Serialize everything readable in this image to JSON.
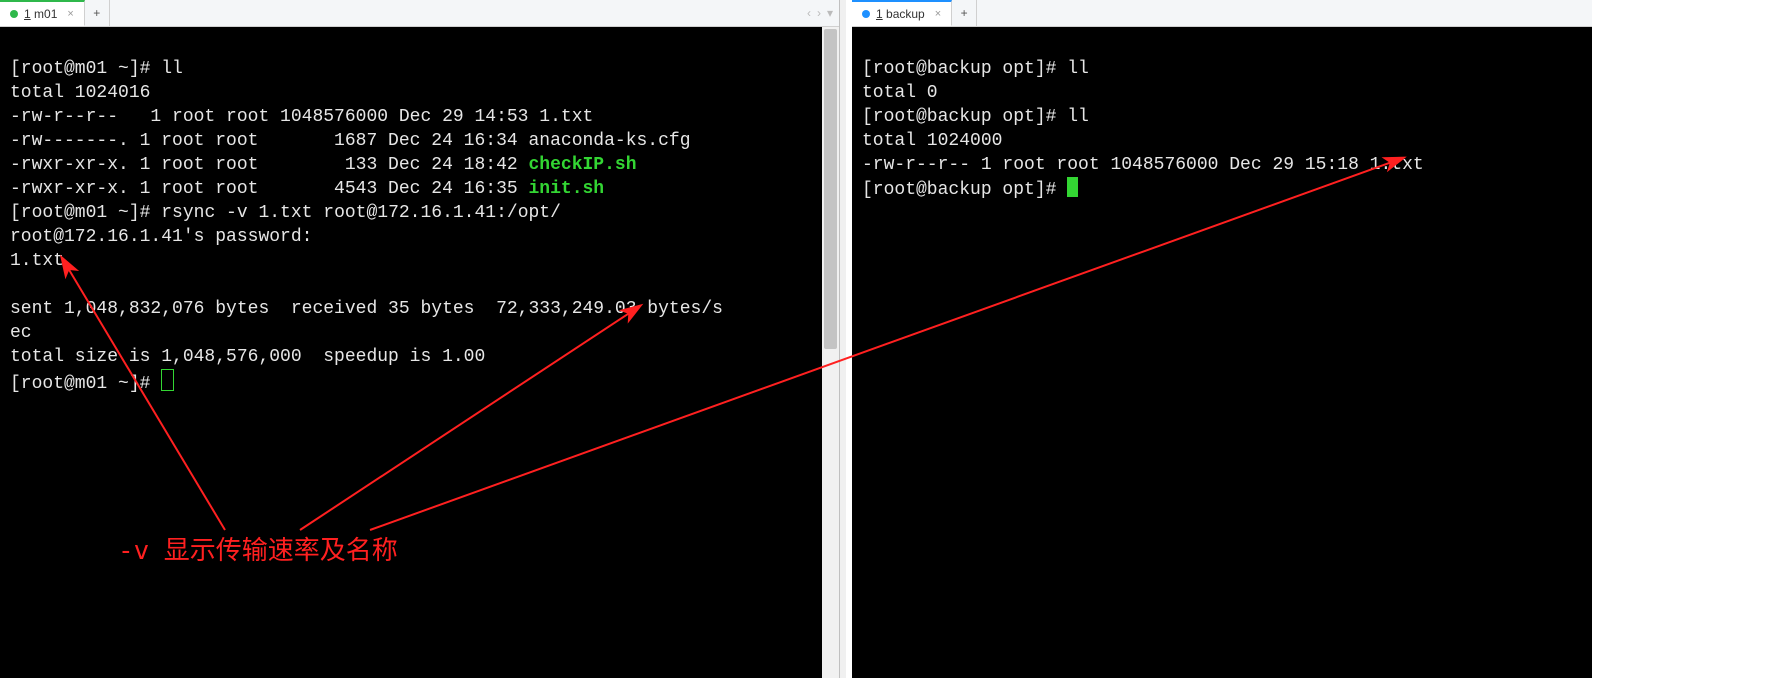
{
  "left": {
    "tab": {
      "number": "1",
      "name": "m01"
    },
    "lines": {
      "l0": {
        "prompt": "[root@m01 ~]# ",
        "cmd": "ll"
      },
      "l1": "total 1024016",
      "l2": "-rw-r--r--   1 root root 1048576000 Dec 29 14:53 1.txt",
      "l3": "-rw-------. 1 root root       1687 Dec 24 16:34 anaconda-ks.cfg",
      "l4a": "-rwxr-xr-x. 1 root root        133 Dec 24 18:42 ",
      "l4b": "checkIP.sh",
      "l5a": "-rwxr-xr-x. 1 root root       4543 Dec 24 16:35 ",
      "l5b": "init.sh",
      "l6": {
        "prompt": "[root@m01 ~]# ",
        "cmd": "rsync -v 1.txt root@172.16.1.41:/opt/"
      },
      "l7": "root@172.16.1.41's password:",
      "l8": "1.txt",
      "l9": "",
      "l10": "sent 1,048,832,076 bytes  received 35 bytes  72,333,249.03 bytes/s",
      "l10b": "ec",
      "l11": "total size is 1,048,576,000  speedup is 1.00",
      "l12": {
        "prompt": "[root@m01 ~]# "
      }
    }
  },
  "right": {
    "tab": {
      "number": "1",
      "name": "backup"
    },
    "lines": {
      "r0": {
        "prompt": "[root@backup opt]# ",
        "cmd": "ll"
      },
      "r1": "total 0",
      "r2": {
        "prompt": "[root@backup opt]# ",
        "cmd": "ll"
      },
      "r3": "total 1024000",
      "r4": "-rw-r--r-- 1 root root 1048576000 Dec 29 15:18 1.txt",
      "r5": {
        "prompt": "[root@backup opt]# "
      }
    }
  },
  "annotation": {
    "flag": "-v",
    "text": "显示传输速率及名称"
  },
  "glyphs": {
    "plus": "+",
    "close": "×",
    "left": "‹",
    "right": "›",
    "menu": "▾"
  }
}
